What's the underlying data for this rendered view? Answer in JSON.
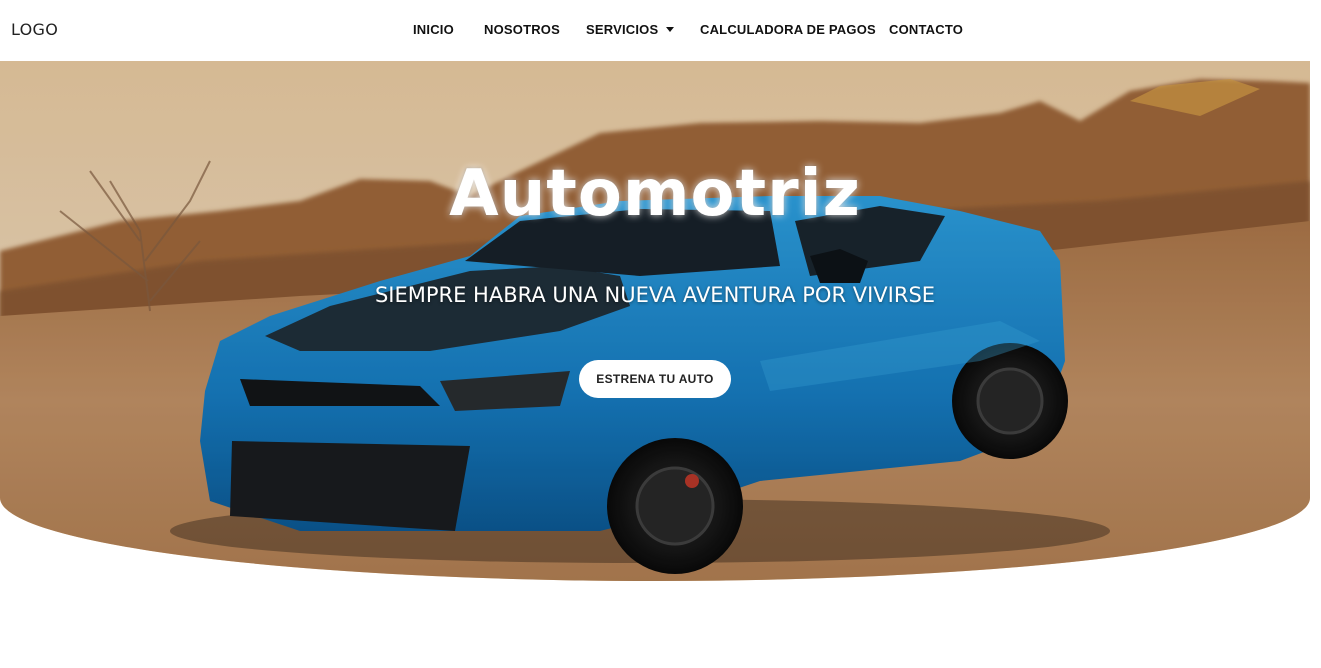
{
  "header": {
    "logo_text": "LOGO",
    "nav": [
      {
        "label": "INICIO"
      },
      {
        "label": "NOSOTROS"
      },
      {
        "label": "SERVICIOS",
        "icon": "caret-down-icon"
      },
      {
        "label": "CALCULADORA DE PAGOS"
      },
      {
        "label": "CONTACTO"
      }
    ]
  },
  "hero": {
    "title": "Automotriz",
    "subtitle": "SIEMPRE HABRA UNA NUEVA AVENTURA POR VIVIRSE",
    "cta_label": "ESTRENA TU AUTO",
    "image_subject": "blue sports car in desert at sunset"
  },
  "colors": {
    "car": "#1f8fd6",
    "sky": "#f6d8b0",
    "ground": "#c99565",
    "text": "#ffffff"
  }
}
